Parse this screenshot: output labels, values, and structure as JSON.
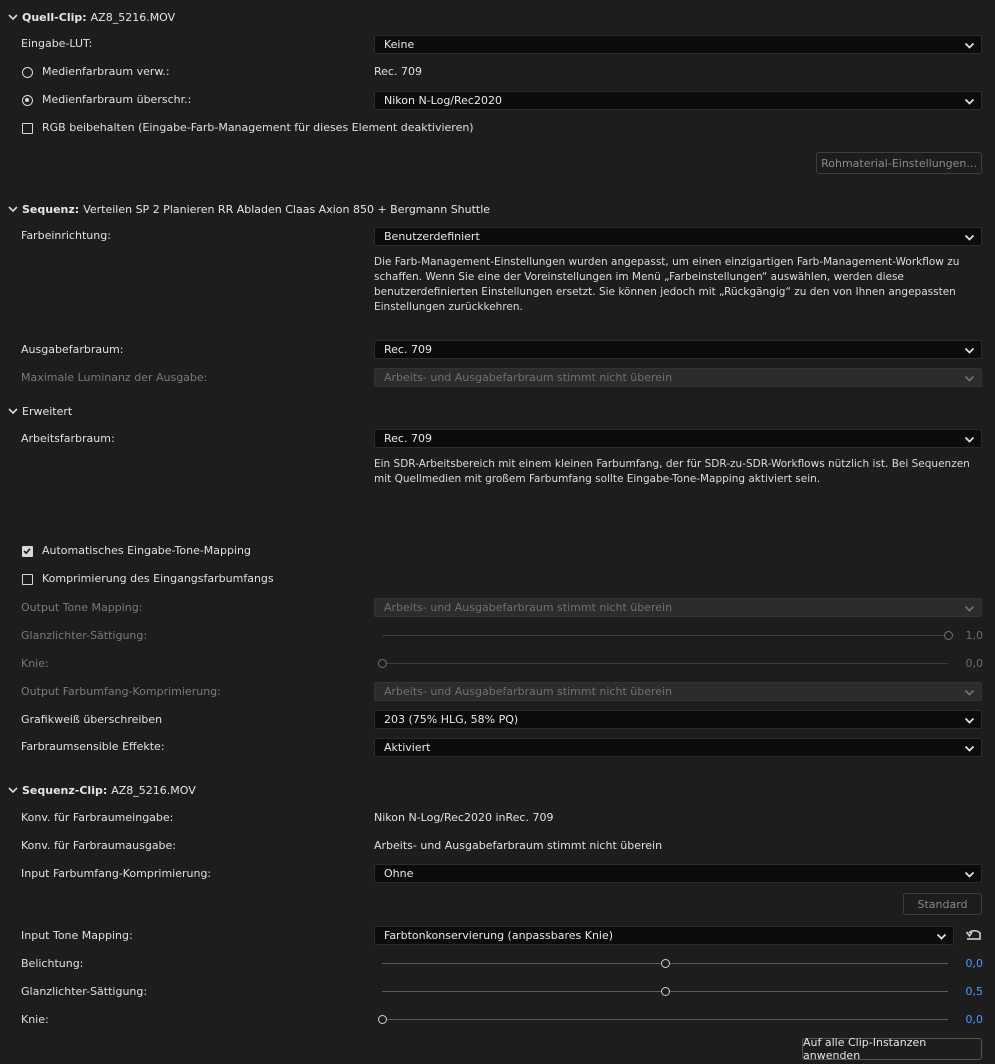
{
  "quell_clip": {
    "header_label": "Quell-Clip:",
    "header_value": "AZ8_5216.MOV",
    "eingabe_lut_label": "Eingabe-LUT:",
    "eingabe_lut_value": "Keine",
    "medienfarbraum_verw_label": "Medienfarbraum verw.:",
    "medienfarbraum_verw_value": "Rec. 709",
    "medienfarbraum_ueberschr_label": "Medienfarbraum überschr.:",
    "medienfarbraum_ueberschr_value": "Nikon N-Log/Rec2020",
    "rgb_beibehalten_label": "RGB beibehalten (Eingabe-Farb-Management für dieses Element deaktivieren)",
    "rohmaterial_button": "Rohmaterial-Einstellungen..."
  },
  "sequenz": {
    "header_label": "Sequenz:",
    "header_value": "Verteilen SP 2 Planieren RR Abladen Claas Axion 850 + Bergmann Shuttle",
    "farbeinrichtung_label": "Farbeinrichtung:",
    "farbeinrichtung_value": "Benutzerdefiniert",
    "farbeinrichtung_desc": "Die Farb-Management-Einstellungen wurden angepasst, um einen einzigartigen Farb-Management-Workflow zu schaffen. Wenn Sie eine der Voreinstellungen im Menü „Farbeinstellungen“ auswählen, werden diese benutzerdefinierten Einstellungen ersetzt. Sie können jedoch mit „Rückgängig“ zu den von Ihnen angepassten Einstellungen zurückkehren.",
    "ausgabefarbraum_label": "Ausgabefarbraum:",
    "ausgabefarbraum_value": "Rec. 709",
    "max_luminanz_label": "Maximale Luminanz der Ausgabe:",
    "max_luminanz_value": "Arbeits- und Ausgabefarbraum stimmt nicht überein"
  },
  "erweitert": {
    "header_label": "Erweitert",
    "arbeitsfarbraum_label": "Arbeitsfarbraum:",
    "arbeitsfarbraum_value": "Rec. 709",
    "arbeitsfarbraum_desc": "Ein SDR-Arbeitsbereich mit einem kleinen Farbumfang, der für SDR-zu-SDR-Workflows nützlich ist. Bei Sequenzen mit Quellmedien mit großem Farbumfang sollte Eingabe-Tone-Mapping aktiviert sein.",
    "auto_tone_mapping_label": "Automatisches Eingabe-Tone-Mapping",
    "komprimierung_label": "Komprimierung des Eingangsfarbumfangs",
    "output_tone_mapping_label": "Output Tone Mapping:",
    "output_tone_mapping_value": "Arbeits- und Ausgabefarbraum stimmt nicht überein",
    "glanzlichter_label": "Glanzlichter-Sättigung:",
    "glanzlichter_value": "1,0",
    "glanzlichter_level": 1.0,
    "knie_label": "Knie:",
    "knie_value": "0,0",
    "knie_level": 0.0,
    "output_farbumfang_label": "Output Farbumfang-Komprimierung:",
    "output_farbumfang_value": "Arbeits- und Ausgabefarbraum stimmt nicht überein",
    "grafikweiss_label": "Grafikweiß überschreiben",
    "grafikweiss_value": "203 (75% HLG, 58% PQ)",
    "farbraumsensible_label": "Farbraumsensible Effekte:",
    "farbraumsensible_value": "Aktiviert"
  },
  "sequenz_clip": {
    "header_label": "Sequenz-Clip:",
    "header_value": "AZ8_5216.MOV",
    "konv_eingabe_label": "Konv. für Farbraumeingabe:",
    "konv_eingabe_value": "Nikon N-Log/Rec2020 inRec. 709",
    "konv_ausgabe_label": "Konv. für Farbraumausgabe:",
    "konv_ausgabe_value": "Arbeits- und Ausgabefarbraum stimmt nicht überein",
    "input_farbumfang_label": "Input Farbumfang-Komprimierung:",
    "input_farbumfang_value": "Ohne",
    "standard_button": "Standard",
    "input_tone_mapping_label": "Input Tone Mapping:",
    "input_tone_mapping_value": "Farbtonkonservierung (anpassbares Knie)",
    "belichtung_label": "Belichtung:",
    "belichtung_value": "0,0",
    "belichtung_level": 0.5,
    "glanzlichter_label": "Glanzlichter-Sättigung:",
    "glanzlichter_value": "0,5",
    "glanzlichter_level": 0.5,
    "knie_label": "Knie:",
    "knie_value": "0,0",
    "knie_level": 0.0,
    "apply_button": "Auf alle Clip-Instanzen anwenden"
  },
  "colors": {
    "background": "#1d1d1d",
    "accent_value": "#4a9cff"
  }
}
